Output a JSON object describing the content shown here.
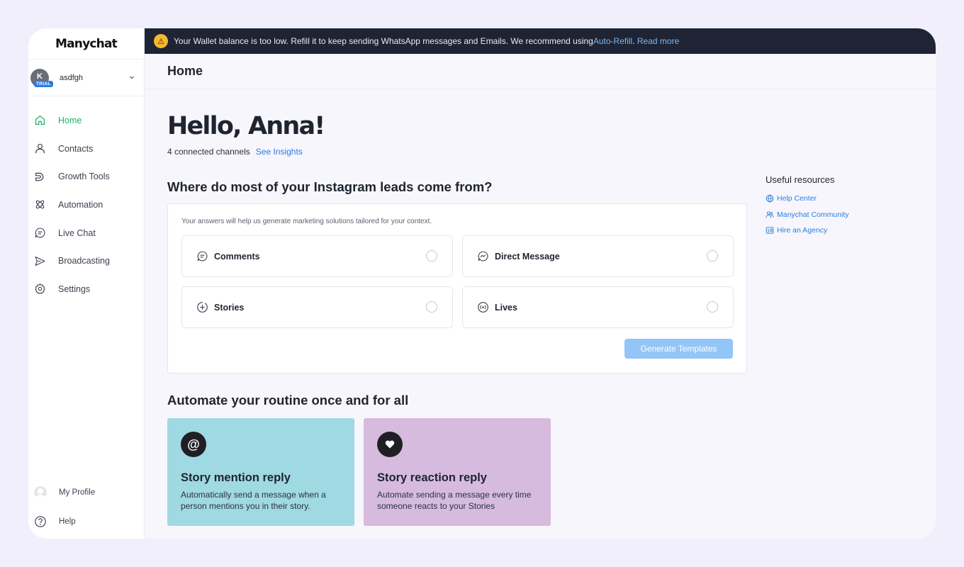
{
  "app": {
    "logo": "Manychat"
  },
  "account": {
    "initial": "K",
    "badge": "TRIAL",
    "name": "asdfgh"
  },
  "sidebar": {
    "items": [
      {
        "label": "Home",
        "icon": "home-icon",
        "active": true
      },
      {
        "label": "Contacts",
        "icon": "user-icon"
      },
      {
        "label": "Growth Tools",
        "icon": "magnet-icon"
      },
      {
        "label": "Automation",
        "icon": "automation-icon"
      },
      {
        "label": "Live Chat",
        "icon": "chat-icon"
      },
      {
        "label": "Broadcasting",
        "icon": "send-icon"
      },
      {
        "label": "Settings",
        "icon": "gear-icon"
      }
    ],
    "bottom": {
      "profile": "My Profile",
      "help": "Help"
    }
  },
  "banner": {
    "icon": "warning-icon",
    "text": "Your Wallet balance is too low. Refill it to keep sending WhatsApp messages and Emails. We recommend using ",
    "link1": "Auto-Refill",
    "sep": ". ",
    "link2": "Read more"
  },
  "header": {
    "title": "Home"
  },
  "greeting": {
    "title": "Hello, Anna!",
    "channels": "4 connected channels",
    "insights_link": "See Insights"
  },
  "leads": {
    "title": "Where do most of your Instagram leads come from?",
    "hint": "Your answers will help us generate marketing solutions tailored for your context.",
    "options": [
      {
        "label": "Comments",
        "icon": "comment-icon"
      },
      {
        "label": "Direct Message",
        "icon": "direct-message-icon"
      },
      {
        "label": "Stories",
        "icon": "story-plus-icon"
      },
      {
        "label": "Lives",
        "icon": "live-broadcast-icon"
      }
    ],
    "button": "Generate Templates",
    "button_color": "#93c5f7"
  },
  "automate": {
    "title": "Automate your routine once and for all",
    "tiles": [
      {
        "icon": "at-sign-icon",
        "title": "Story mention reply",
        "desc": "Automatically send a message when a person mentions you in their story.",
        "color": "#9fd9e2"
      },
      {
        "icon": "heart-icon",
        "title": "Story reaction reply",
        "desc": "Automate sending a message every time someone reacts to your Stories",
        "color": "#d6bbdf"
      }
    ]
  },
  "resources": {
    "title": "Useful resources",
    "items": [
      {
        "label": "Help Center",
        "icon": "globe-icon"
      },
      {
        "label": "Manychat Community",
        "icon": "community-icon"
      },
      {
        "label": "Hire an Agency",
        "icon": "agency-icon"
      }
    ]
  },
  "colors": {
    "accent": "#1db36a",
    "link": "#2c7be5",
    "banner_bg": "#1e2433"
  }
}
